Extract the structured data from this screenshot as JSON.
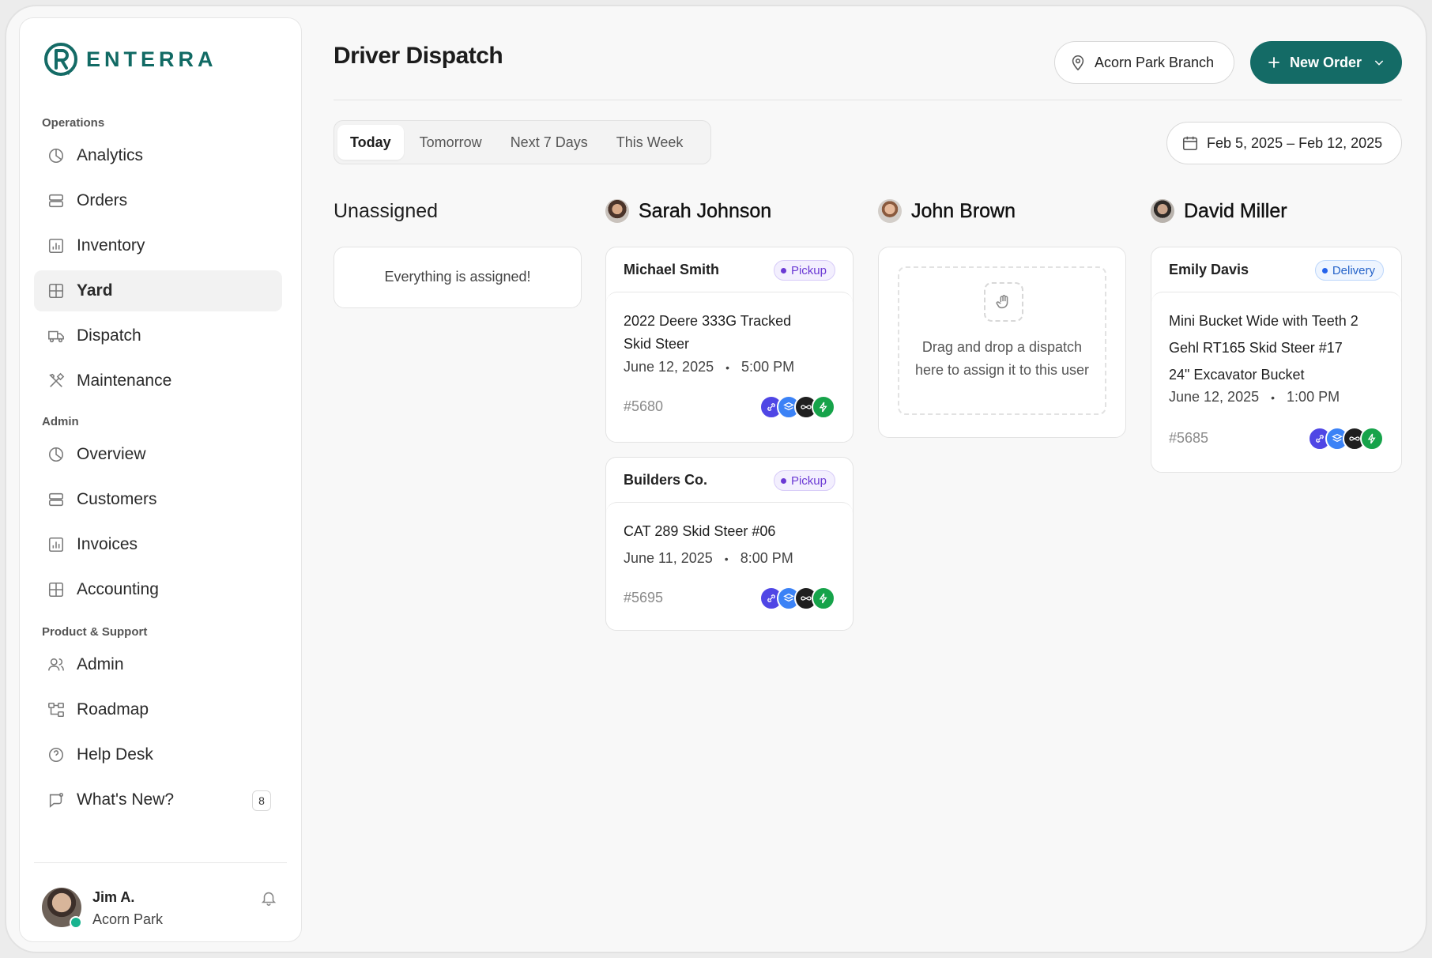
{
  "brand": {
    "name": "ENTERRA",
    "accent": "#146b66"
  },
  "sidebar": {
    "sections": [
      {
        "label": "Operations"
      },
      {
        "label": "Admin"
      },
      {
        "label": "Product & Support"
      }
    ],
    "items": [
      {
        "label": "Analytics",
        "icon": "pie-chart-icon"
      },
      {
        "label": "Orders",
        "icon": "rows-icon"
      },
      {
        "label": "Inventory",
        "icon": "bar-chart-icon"
      },
      {
        "label": "Yard",
        "icon": "grid-icon",
        "active": true
      },
      {
        "label": "Dispatch",
        "icon": "truck-icon"
      },
      {
        "label": "Maintenance",
        "icon": "tools-icon"
      },
      {
        "label": "Overview",
        "icon": "pie-chart-icon"
      },
      {
        "label": "Customers",
        "icon": "rows-icon"
      },
      {
        "label": "Invoices",
        "icon": "bar-chart-icon"
      },
      {
        "label": "Accounting",
        "icon": "grid-icon"
      },
      {
        "label": "Admin",
        "icon": "users-icon"
      },
      {
        "label": "Roadmap",
        "icon": "roadmap-icon"
      },
      {
        "label": "Help Desk",
        "icon": "help-icon"
      },
      {
        "label": "What's New?",
        "icon": "chat-icon",
        "badge": "8"
      }
    ],
    "user": {
      "name": "Jim A.",
      "location": "Acorn Park",
      "status_color": "#18b38f"
    }
  },
  "header": {
    "title": "Driver Dispatch",
    "branch": "Acorn Park Branch",
    "new_order": "New Order"
  },
  "filters": {
    "tabs": [
      "Today",
      "Tomorrow",
      "Next 7 Days",
      "This Week"
    ],
    "active_tab": "Today",
    "date_range": "Feb 5, 2025 – Feb 12, 2025"
  },
  "columns": [
    {
      "title": "Unassigned",
      "empty_message": "Everything is assigned!"
    },
    {
      "title": "Sarah Johnson",
      "cards": [
        {
          "customer": "Michael Smith",
          "type": "Pickup",
          "items": [
            "2022 Deere 333G Tracked",
            "Skid Steer"
          ],
          "date": "June 12, 2025",
          "time": "5:00 PM",
          "order": "#5680"
        },
        {
          "customer": "Builders Co.",
          "type": "Pickup",
          "items": [
            "CAT 289 Skid Steer #06"
          ],
          "date": "June 11, 2025",
          "time": "8:00 PM",
          "order": "#5695"
        }
      ]
    },
    {
      "title": "John Brown",
      "drop_message": "Drag and drop a dispatch here to assign it to this user"
    },
    {
      "title": "David Miller",
      "cards": [
        {
          "customer": "Emily Davis",
          "type": "Delivery",
          "items": [
            "Mini Bucket Wide with Teeth 2",
            "Gehl RT165 Skid Steer #17",
            "24\" Excavator Bucket"
          ],
          "date": "June 12, 2025",
          "time": "1:00 PM",
          "order": "#5685"
        }
      ]
    }
  ],
  "separator": "•",
  "badge_colors": {
    "pickup": "#6b39d4",
    "delivery": "#2563eb"
  },
  "integration_icons": [
    "link-icon",
    "layers-icon",
    "infinity-icon",
    "bolt-icon"
  ]
}
